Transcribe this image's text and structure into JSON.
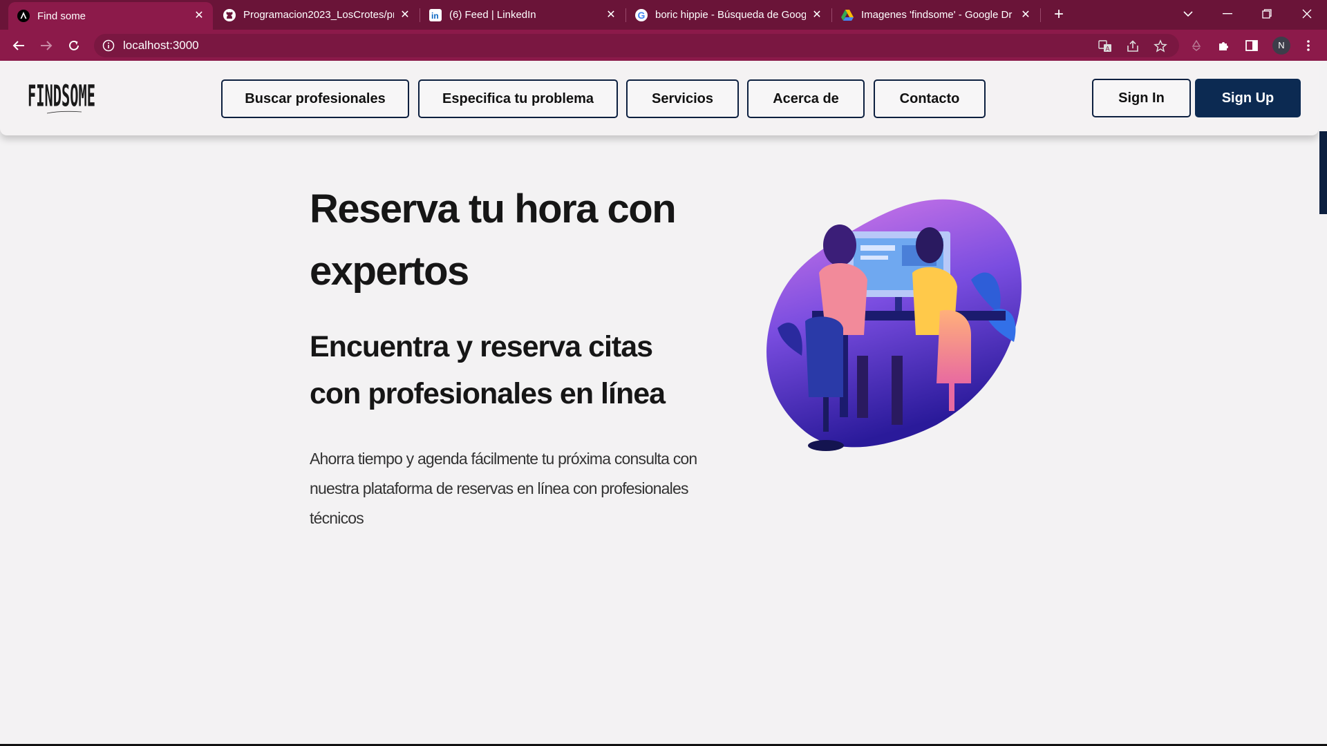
{
  "browser": {
    "tabs": [
      {
        "title": "Find some",
        "icon": "angular-icon",
        "active": true
      },
      {
        "title": "Programacion2023_LosCrotes/pr",
        "icon": "github-icon",
        "active": false
      },
      {
        "title": "(6) Feed | LinkedIn",
        "icon": "linkedin-icon",
        "active": false
      },
      {
        "title": "boric hippie - Búsqueda de Goog",
        "icon": "google-icon",
        "active": false
      },
      {
        "title": "Imagenes 'findsome' - Google Dr",
        "icon": "google-drive-icon",
        "active": false
      }
    ],
    "url": "localhost:3000",
    "profile_initial": "N",
    "colors": {
      "tabbar": "#6a1438",
      "toolbar": "#8c1a4a"
    }
  },
  "header": {
    "logo_text": "FINDSOME",
    "nav": [
      "Buscar profesionales",
      "Especifica tu problema",
      "Servicios",
      "Acerca de",
      "Contacto"
    ],
    "sign_in": "Sign In",
    "sign_up": "Sign Up",
    "colors": {
      "primary": "#0c2a52"
    }
  },
  "hero": {
    "title": "Reserva tu hora con expertos",
    "subtitle": "Encuentra y reserva citas con profesionales en línea",
    "description": "Ahorra tiempo y agenda fácilmente tu próxima consulta con nuestra plataforma de reservas en línea con profesionales técnicos"
  }
}
